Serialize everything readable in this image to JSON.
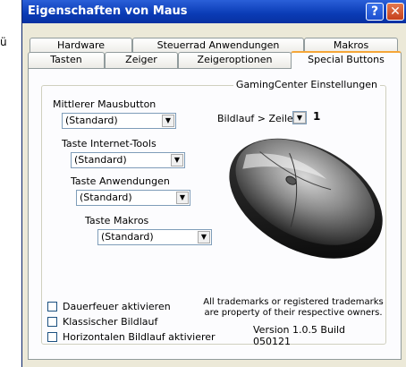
{
  "background_fragment": "ü",
  "window": {
    "title": "Eigenschaften von Maus"
  },
  "tabs_row1": [
    "Hardware",
    "Steuerrad Anwendungen",
    "Makros"
  ],
  "tabs_row2": [
    "Tasten",
    "Zeiger",
    "Zeigeroptionen",
    "Special Buttons"
  ],
  "active_tab": "Special Buttons",
  "group": {
    "title": "GamingCenter Einstellungen",
    "middle_button": {
      "label": "Mittlerer Mausbutton",
      "value": "(Standard)"
    },
    "internet_tools": {
      "label": "Taste Internet-Tools",
      "value": "(Standard)"
    },
    "applications": {
      "label": "Taste Anwendungen",
      "value": "(Standard)"
    },
    "macros": {
      "label": "Taste Makros",
      "value": "(Standard)"
    },
    "scroll": {
      "label": "Bildlauf > Zeilen",
      "value": "1"
    },
    "checkboxes": [
      {
        "label": "Dauerfeuer aktivieren",
        "checked": false
      },
      {
        "label": "Klassischer Bildlauf",
        "checked": false
      },
      {
        "label": "Horizontalen Bildlauf aktivierer",
        "checked": false
      }
    ],
    "trademark_line1": "All trademarks or registered trademarks",
    "trademark_line2": "are property of their respective owners.",
    "version": "Version 1.0.5 Build 050121"
  }
}
